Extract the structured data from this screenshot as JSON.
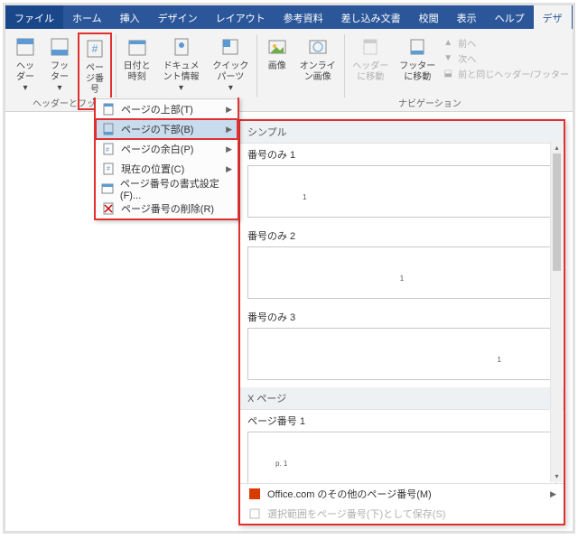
{
  "tabs": {
    "file": "ファイル",
    "home": "ホーム",
    "insert": "挿入",
    "design": "デザイン",
    "layout": "レイアウト",
    "references": "参考資料",
    "mailings": "差し込み文書",
    "review": "校閲",
    "view": "表示",
    "help": "ヘルプ",
    "designTool": "デザ"
  },
  "ribbon": {
    "header": "ヘッダー",
    "footer": "フッター",
    "pageNumber": "ページ番号",
    "dateTime": "日付と時刻",
    "docInfo": "ドキュメント情報",
    "quick": "クイックパーツ",
    "image": "画像",
    "online": "オンライン画像",
    "goHeader": "ヘッダーに移動",
    "goFooter": "フッターに移動",
    "prev": "前へ",
    "next": "次へ",
    "sameAsPrev": "前と同じヘッダー/フッター",
    "groupHF": "ヘッダーとフッ",
    "groupNav": "ナビゲーション"
  },
  "menu": {
    "top": "ページの上部(T)",
    "bottom": "ページの下部(B)",
    "margin": "ページの余白(P)",
    "current": "現在の位置(C)",
    "format": "ページ番号の書式設定(F)...",
    "remove": "ページ番号の削除(R)"
  },
  "gallery": {
    "simple": "シンプル",
    "item1": "番号のみ 1",
    "item2": "番号のみ 2",
    "item3": "番号のみ 3",
    "xpage": "X ページ",
    "item4": "ページ番号 1",
    "p4text": "p. 1",
    "office": "Office.com のその他のページ番号(M)",
    "save": "選択範囲をページ番号(下)として保存(S)"
  }
}
